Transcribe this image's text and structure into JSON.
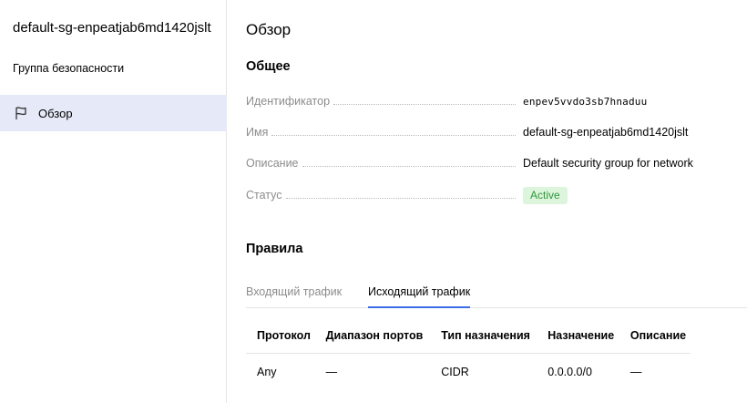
{
  "sidebar": {
    "title": "default-sg-enpeatjab6md1420jslt",
    "subtitle": "Группа безопасности",
    "items": [
      {
        "label": "Обзор",
        "icon": "flag-icon",
        "active": true
      }
    ]
  },
  "main": {
    "title": "Обзор",
    "general": {
      "title": "Общее",
      "fields": [
        {
          "key": "Идентификатор",
          "value": "enpev5vvdo3sb7hnaduu"
        },
        {
          "key": "Имя",
          "value": "default-sg-enpeatjab6md1420jslt"
        },
        {
          "key": "Описание",
          "value": "Default security group for network"
        },
        {
          "key": "Статус",
          "value": "Active"
        }
      ]
    },
    "rules": {
      "title": "Правила",
      "tabs": [
        {
          "label": "Входящий трафик",
          "active": false
        },
        {
          "label": "Исходящий трафик",
          "active": true
        }
      ],
      "columns": [
        "Протокол",
        "Диапазон портов",
        "Тип назначения",
        "Назначение",
        "Описание"
      ],
      "rows": [
        [
          "Any",
          "—",
          "CIDR",
          "0.0.0.0/0",
          "—"
        ]
      ]
    }
  },
  "colors": {
    "accent": "#3d6ce5",
    "sidebar_active": "#e6eaf8",
    "status_bg": "#dcf5dc",
    "status_text": "#2e9a3a",
    "muted_text": "#8c8c8c"
  }
}
